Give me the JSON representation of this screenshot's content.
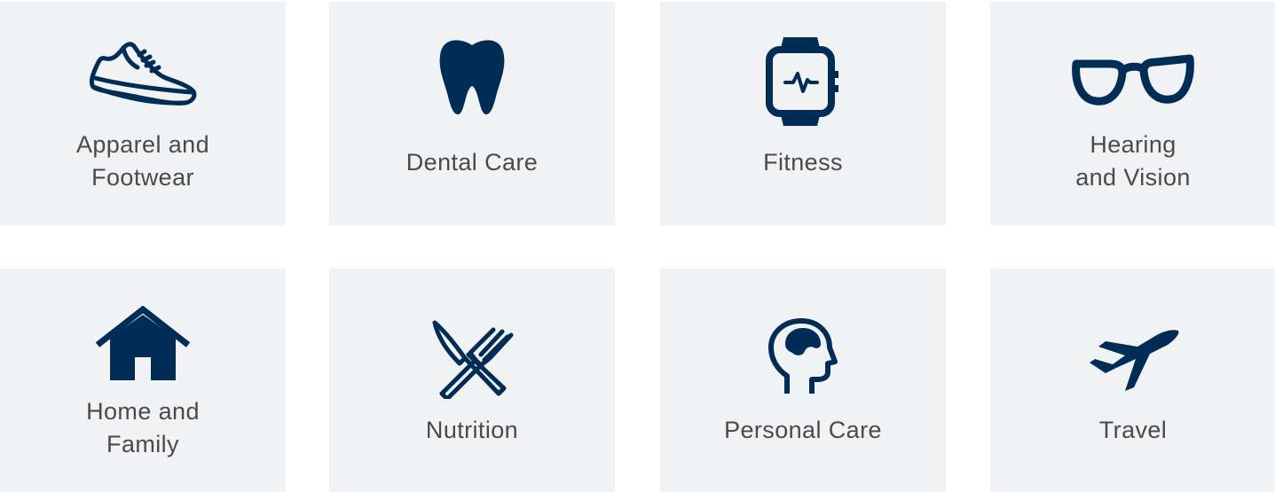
{
  "theme": {
    "icon_color": "#002d55",
    "tile_background": "#f1f2f4",
    "label_color": "#4a4a4a"
  },
  "categories": [
    {
      "label_lines": [
        "Apparel and",
        "Footwear"
      ],
      "icon": "shoe-icon"
    },
    {
      "label_lines": [
        "Dental Care"
      ],
      "icon": "tooth-icon"
    },
    {
      "label_lines": [
        "Fitness"
      ],
      "icon": "smartwatch-icon"
    },
    {
      "label_lines": [
        "Hearing",
        "and Vision"
      ],
      "icon": "glasses-icon"
    },
    {
      "label_lines": [
        "Home and",
        "Family"
      ],
      "icon": "house-icon"
    },
    {
      "label_lines": [
        "Nutrition"
      ],
      "icon": "fork-and-knife-icon"
    },
    {
      "label_lines": [
        "Personal Care"
      ],
      "icon": "head-brain-icon"
    },
    {
      "label_lines": [
        "Travel"
      ],
      "icon": "airplane-icon"
    }
  ]
}
